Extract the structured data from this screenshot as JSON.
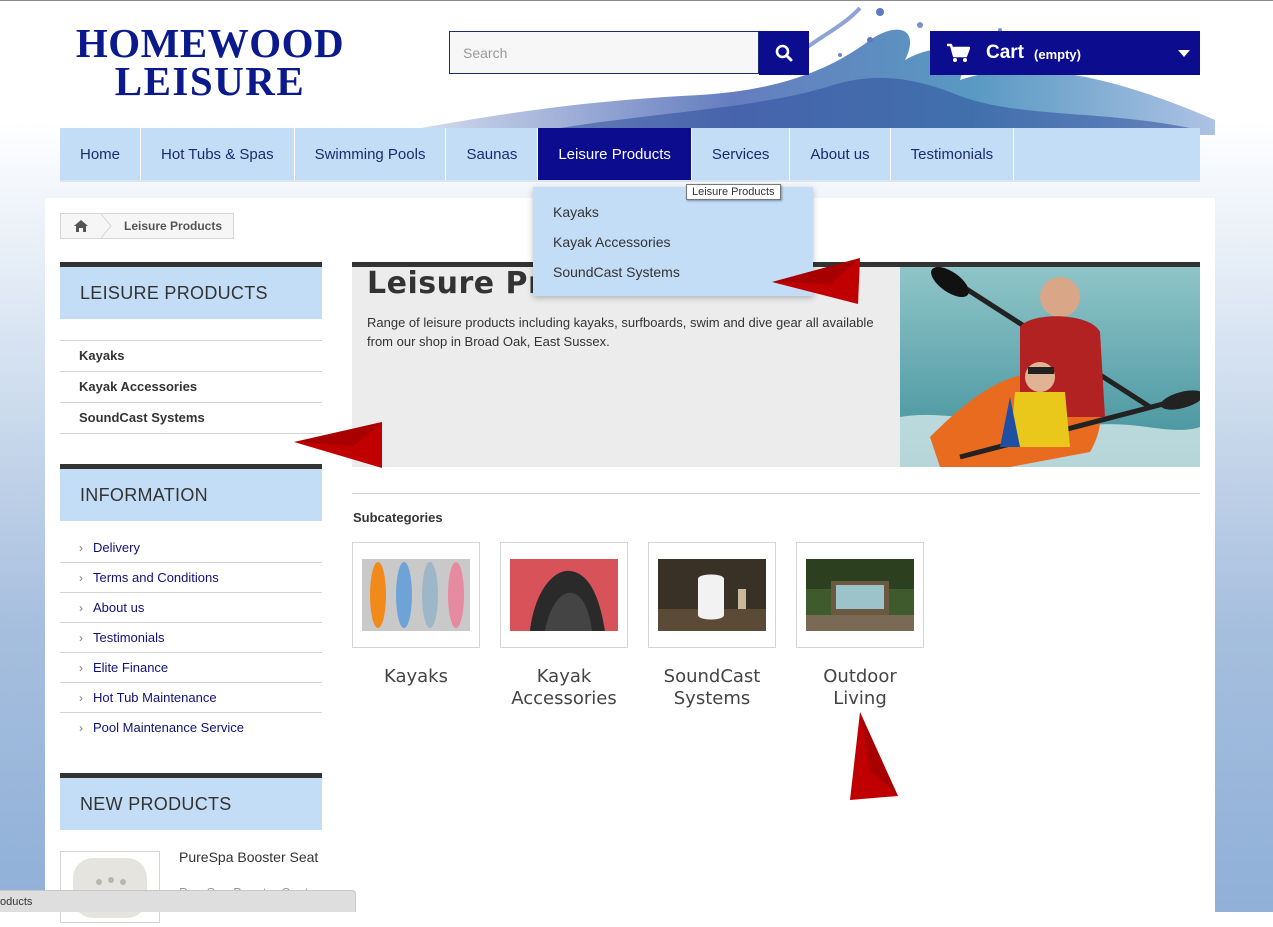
{
  "logo": {
    "line1": "HOMEWOOD",
    "line2": "LEISURE"
  },
  "search": {
    "placeholder": "Search"
  },
  "cart": {
    "label": "Cart",
    "status": "(empty)"
  },
  "nav": {
    "items": [
      {
        "label": "Home"
      },
      {
        "label": "Hot Tubs & Spas"
      },
      {
        "label": "Swimming Pools"
      },
      {
        "label": "Saunas"
      },
      {
        "label": "Leisure Products"
      },
      {
        "label": "Services"
      },
      {
        "label": "About us"
      },
      {
        "label": "Testimonials"
      }
    ],
    "tooltip": "Leisure Products",
    "dropdown": [
      "Kayaks",
      "Kayak Accessories",
      "SoundCast Systems"
    ]
  },
  "breadcrumb": {
    "current": "Leisure Products"
  },
  "sidebar": {
    "categories_title": "LEISURE PRODUCTS",
    "categories": [
      "Kayaks",
      "Kayak Accessories",
      "SoundCast Systems"
    ],
    "information_title": "INFORMATION",
    "information": [
      "Delivery",
      "Terms and Conditions",
      "About us",
      "Testimonials",
      "Elite Finance",
      "Hot Tub Maintenance",
      "Pool Maintenance Service"
    ],
    "new_products_title": "NEW PRODUCTS",
    "new_product_name": "PureSpa Booster Seat",
    "new_product_sub": "PureSpa Booster Seat"
  },
  "category": {
    "title": "Leisure Products",
    "description": "Range of leisure products including kayaks, surfboards, swim and dive gear all available from our shop in Broad Oak, East Sussex."
  },
  "subcategories": {
    "label": "Subcategories",
    "items": [
      {
        "name": "Kayaks"
      },
      {
        "name": "Kayak Accessories"
      },
      {
        "name": "SoundCast Systems"
      },
      {
        "name": "Outdoor Living"
      }
    ]
  },
  "statusbar": {
    "text": "oducts"
  },
  "colors": {
    "brand": "#0c0c8f",
    "nav_bg": "#c3ddf6",
    "arrow": "#c00000"
  }
}
